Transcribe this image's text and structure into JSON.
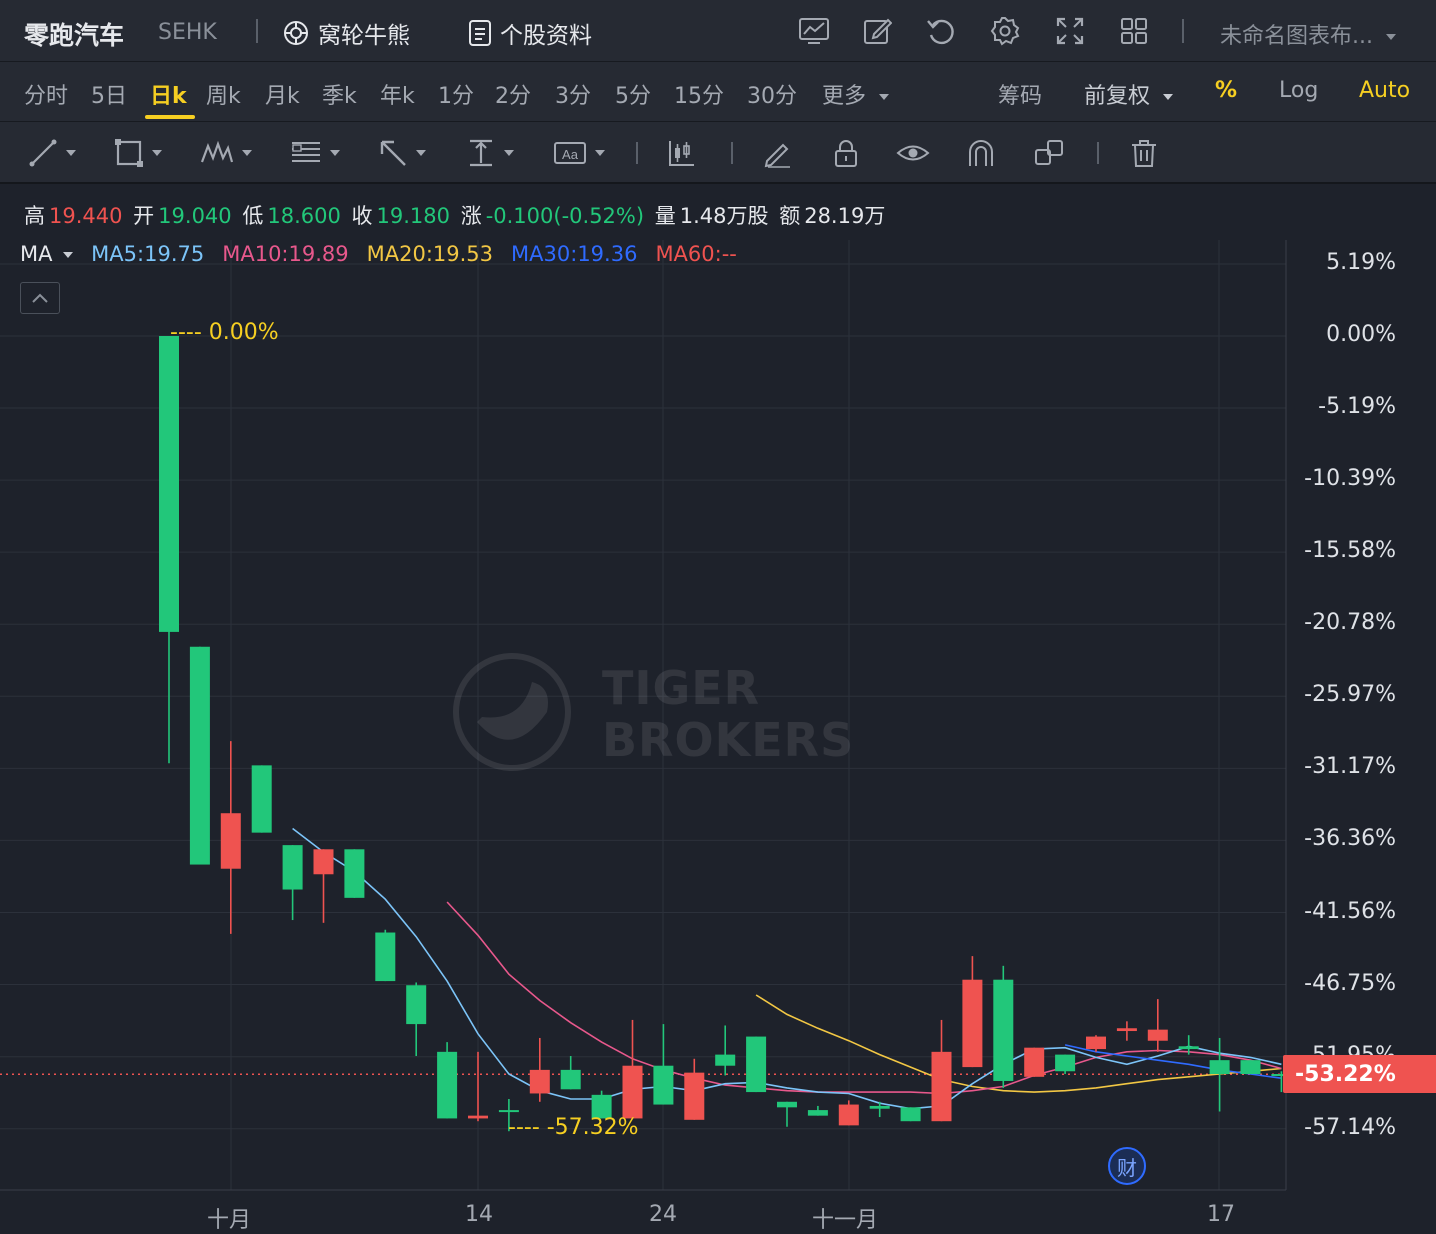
{
  "header": {
    "stock_name": "零跑汽车",
    "exchange": "SEHK",
    "warrants_label": "窝轮牛熊",
    "profile_label": "个股资料",
    "layout_name": "未命名图表布..."
  },
  "periods": [
    "分时",
    "5日",
    "日k",
    "周k",
    "月k",
    "季k",
    "年k",
    "1分",
    "2分",
    "3分",
    "5分",
    "15分",
    "30分",
    "更多"
  ],
  "active_period": "日k",
  "chart_options": {
    "chips": "筹码",
    "adjust": "前复权",
    "percent": "%",
    "log": "Log",
    "auto": "Auto"
  },
  "ohlc": {
    "high_label": "高",
    "high": "19.440",
    "open_label": "开",
    "open": "19.040",
    "low_label": "低",
    "low": "18.600",
    "close_label": "收",
    "close": "19.180",
    "change_label": "涨",
    "change": "-0.100(-0.52%)",
    "volume_label": "量",
    "volume": "1.48万股",
    "amount_label": "额",
    "amount": "28.19万"
  },
  "ma": {
    "label": "MA",
    "ma5": "MA5:19.75",
    "ma10": "MA10:19.89",
    "ma20": "MA20:19.53",
    "ma30": "MA30:19.36",
    "ma60": "MA60:--"
  },
  "colors": {
    "up": "#ef5350",
    "down": "#22c77a",
    "ma5": "#7cc4f8",
    "ma10": "#e8588c",
    "ma20": "#f2c744",
    "ma30": "#2f6bff",
    "ma60": "#ef5350",
    "accent": "#f6cf22"
  },
  "y_axis_labels": [
    "5.19%",
    "0.00%",
    "-5.19%",
    "-10.39%",
    "-15.58%",
    "-20.78%",
    "-25.97%",
    "-31.17%",
    "-36.36%",
    "-41.56%",
    "-46.75%",
    "-51.95%",
    "-57.14%"
  ],
  "x_axis_labels": [
    "十月",
    "14",
    "24",
    "十一月",
    "17"
  ],
  "current_price_tag": "-53.22%",
  "annotations": {
    "high_mark": "---- 0.00%",
    "low_mark": "---- -57.32%"
  },
  "finance_badge": "财",
  "watermark": [
    "TIGER",
    "BROKERS"
  ],
  "icons": [
    "indicator-icon",
    "draw-icon",
    "undo-icon",
    "settings-icon",
    "fullscreen-icon",
    "layout-grid-icon",
    "line-tool-icon",
    "rect-tool-icon",
    "pattern-tool-icon",
    "fib-tool-icon",
    "arrow-tool-icon",
    "measure-tool-icon",
    "text-tool-icon",
    "candle-tool-icon",
    "pencil-icon",
    "lock-icon",
    "eye-icon",
    "magnet-icon",
    "clone-icon",
    "trash-icon"
  ],
  "chart_data": {
    "type": "candlestick",
    "y_scale": "percent change from first close",
    "y_ticks": [
      5.19,
      0.0,
      -5.19,
      -10.39,
      -15.58,
      -20.78,
      -25.97,
      -31.17,
      -36.36,
      -41.56,
      -46.75,
      -51.95,
      -57.14
    ],
    "current_value": -53.22,
    "candles": [
      {
        "o": 0.0,
        "c": -21.33,
        "h": 0.0,
        "l": -30.8
      },
      {
        "o": -22.4,
        "c": -38.1,
        "h": -22.4,
        "l": -38.1
      },
      {
        "o": -38.4,
        "c": -34.4,
        "h": -29.2,
        "l": -43.1
      },
      {
        "o": -30.95,
        "c": -35.8,
        "h": -30.95,
        "l": -35.8
      },
      {
        "o": -36.7,
        "c": -39.9,
        "h": -36.7,
        "l": -42.1
      },
      {
        "o": -38.8,
        "c": -37.0,
        "h": -37.0,
        "l": -42.3
      },
      {
        "o": -37.0,
        "c": -40.5,
        "h": -37.0,
        "l": -40.5
      },
      {
        "o": -43.0,
        "c": -46.5,
        "h": -42.8,
        "l": -46.5
      },
      {
        "o": -46.8,
        "c": -49.6,
        "h": -46.6,
        "l": -51.9
      },
      {
        "o": -51.6,
        "c": -56.4,
        "h": -50.9,
        "l": -56.4
      },
      {
        "o": -56.4,
        "c": -56.2,
        "h": -51.6,
        "l": -56.6
      },
      {
        "o": -55.8,
        "c": -55.9,
        "h": -55.0,
        "l": -57.32
      },
      {
        "o": -54.6,
        "c": -52.9,
        "h": -50.6,
        "l": -55.2
      },
      {
        "o": -52.9,
        "c": -54.3,
        "h": -51.9,
        "l": -54.3
      },
      {
        "o": -54.7,
        "c": -56.4,
        "h": -54.4,
        "l": -56.4
      },
      {
        "o": -56.4,
        "c": -52.6,
        "h": -49.3,
        "l": -56.4
      },
      {
        "o": -52.6,
        "c": -55.4,
        "h": -49.6,
        "l": -55.4
      },
      {
        "o": -56.5,
        "c": -53.1,
        "h": -52.1,
        "l": -56.5
      },
      {
        "o": -51.8,
        "c": -52.6,
        "h": -49.7,
        "l": -53.3
      },
      {
        "o": -50.5,
        "c": -54.5,
        "h": -50.5,
        "l": -54.5
      },
      {
        "o": -55.2,
        "c": -55.6,
        "h": -55.2,
        "l": -57.0
      },
      {
        "o": -55.8,
        "c": -56.2,
        "h": -55.5,
        "l": -56.2
      },
      {
        "o": -56.9,
        "c": -55.4,
        "h": -55.1,
        "l": -56.9
      },
      {
        "o": -55.5,
        "c": -55.7,
        "h": -55.2,
        "l": -56.3
      },
      {
        "o": -55.6,
        "c": -56.6,
        "h": -55.6,
        "l": -56.6
      },
      {
        "o": -56.6,
        "c": -51.6,
        "h": -49.3,
        "l": -56.6
      },
      {
        "o": -52.7,
        "c": -46.4,
        "h": -44.7,
        "l": -52.7
      },
      {
        "o": -46.4,
        "c": -53.7,
        "h": -45.4,
        "l": -54.2
      },
      {
        "o": -53.4,
        "c": -51.3,
        "h": -51.3,
        "l": -53.4
      },
      {
        "o": -51.8,
        "c": -53.0,
        "h": -51.8,
        "l": -53.2
      },
      {
        "o": -51.4,
        "c": -50.5,
        "h": -50.4,
        "l": -51.6
      },
      {
        "o": -50.1,
        "c": -49.9,
        "h": -49.4,
        "l": -50.8
      },
      {
        "o": -50.8,
        "c": -50.0,
        "h": -47.8,
        "l": -51.6
      },
      {
        "o": -51.2,
        "c": -51.4,
        "h": -50.4,
        "l": -51.8
      },
      {
        "o": -52.2,
        "c": -53.2,
        "h": -50.6,
        "l": -55.9
      },
      {
        "o": -52.2,
        "c": -53.2,
        "h": -52.2,
        "l": -53.2
      },
      {
        "o": -53.2,
        "c": -53.22,
        "h": -53.0,
        "l": -54.5
      }
    ],
    "ma5": [
      null,
      null,
      null,
      null,
      -35.5,
      -37.2,
      -38.6,
      -40.6,
      -43.3,
      -46.5,
      -50.3,
      -53.2,
      -54.4,
      -55.0,
      -55.0,
      -54.3,
      -54.1,
      -54.4,
      -53.9,
      -53.8,
      -54.2,
      -54.5,
      -54.6,
      -55.3,
      -55.7,
      -55.5,
      -53.9,
      -52.5,
      -51.4,
      -51.3,
      -52.0,
      -52.5,
      -51.9,
      -51.2,
      -51.7,
      -52.0,
      -52.5
    ],
    "ma10": [
      null,
      null,
      null,
      null,
      null,
      null,
      null,
      null,
      null,
      -40.8,
      -43.2,
      -46.0,
      -47.9,
      -49.5,
      -50.9,
      -52.1,
      -52.9,
      -53.5,
      -54.0,
      -54.2,
      -54.4,
      -54.5,
      -54.5,
      -54.5,
      -54.5,
      -54.6,
      -54.4,
      -54.1,
      -53.3,
      -52.7,
      -52.0,
      -51.6,
      -51.5,
      -51.6,
      -51.8,
      -52.2,
      -52.8
    ],
    "ma20": [
      null,
      null,
      null,
      null,
      null,
      null,
      null,
      null,
      null,
      null,
      null,
      null,
      null,
      null,
      null,
      null,
      null,
      null,
      null,
      -47.5,
      -48.9,
      -49.9,
      -50.8,
      -51.8,
      -52.7,
      -53.6,
      -54.1,
      -54.4,
      -54.5,
      -54.4,
      -54.2,
      -53.9,
      -53.6,
      -53.4,
      -53.2,
      -53.0,
      -52.8
    ],
    "ma30": [
      null,
      null,
      null,
      null,
      null,
      null,
      null,
      null,
      null,
      null,
      null,
      null,
      null,
      null,
      null,
      null,
      null,
      null,
      null,
      null,
      null,
      null,
      null,
      null,
      null,
      null,
      null,
      null,
      null,
      -51.1,
      -51.6,
      -51.9,
      -52.2,
      -52.5,
      -52.9,
      -53.2,
      -53.5
    ]
  }
}
